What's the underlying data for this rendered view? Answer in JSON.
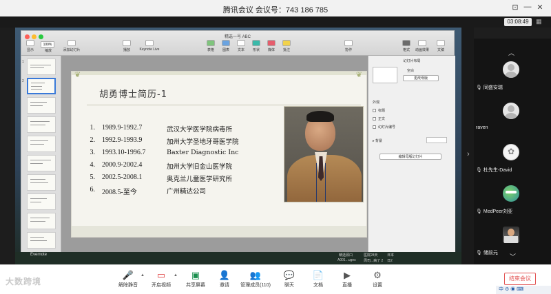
{
  "window": {
    "title": "腾讯会议 会议号：743 186 785",
    "timer": "03:08:49"
  },
  "keynote": {
    "title": "精选一号 ABC",
    "zoom": "100%",
    "toolbar": [
      "显示",
      "缩放",
      "添加幻灯片",
      "播放",
      "Keynote Live",
      "表格",
      "图表",
      "文本",
      "形状",
      "媒体",
      "批注",
      "协作",
      "格式",
      "动画效果",
      "文稿"
    ],
    "inspector": {
      "header": "幻灯片布局",
      "layout_name": "空白",
      "change_master": "更改母版",
      "appearance": "外观",
      "opt_title": "标题",
      "opt_body": "正文",
      "opt_slide_number": "幻灯片编号",
      "background": "背景",
      "edit_master": "编辑母版幻灯片"
    }
  },
  "slide": {
    "title": "胡勇博士简历-1",
    "entries": [
      {
        "n": "1.",
        "period": "1989.9-1992.7",
        "desc": "武汉大学医学院病毒所"
      },
      {
        "n": "2.",
        "period": "1992.9-1993.9",
        "desc": "加州大学圣地牙哥医学院"
      },
      {
        "n": "3.",
        "period": "1993.10-1996.7",
        "desc": "Baxter Diagnostic Inc"
      },
      {
        "n": "4.",
        "period": "2000.9-2002.4",
        "desc": "加州大学旧金山医学院"
      },
      {
        "n": "5.",
        "period": "2002.5-2008.1",
        "desc": "奥克兰儿童医学研究所"
      },
      {
        "n": "6.",
        "period": "2008.5-至今",
        "desc": "广州精达公司"
      }
    ]
  },
  "desktop": {
    "evernote": "Evernote",
    "fileA": "精选源口",
    "fileB": "A001...uges",
    "fileC": "医院28天",
    "fileD": "周司...病了 2",
    "fileE": "日本",
    "fileF": "日2"
  },
  "participants": [
    {
      "name": "同盛安瑞",
      "avatar": "default"
    },
    {
      "name": "raven",
      "avatar": "default"
    },
    {
      "name": "杜先生-David",
      "avatar": "flower"
    },
    {
      "name": "MedPeer刘亚",
      "avatar": "globe"
    },
    {
      "name": "储前元",
      "avatar": "person"
    }
  ],
  "bottom": {
    "logo": "大数跨境",
    "buttons": [
      "解除静音",
      "开启视频",
      "共享屏幕",
      "邀请",
      "管理成员(110)",
      "聊天",
      "文档",
      "直播",
      "设置"
    ],
    "end": "结束会议"
  },
  "taskbar": {
    "ime": "中"
  }
}
